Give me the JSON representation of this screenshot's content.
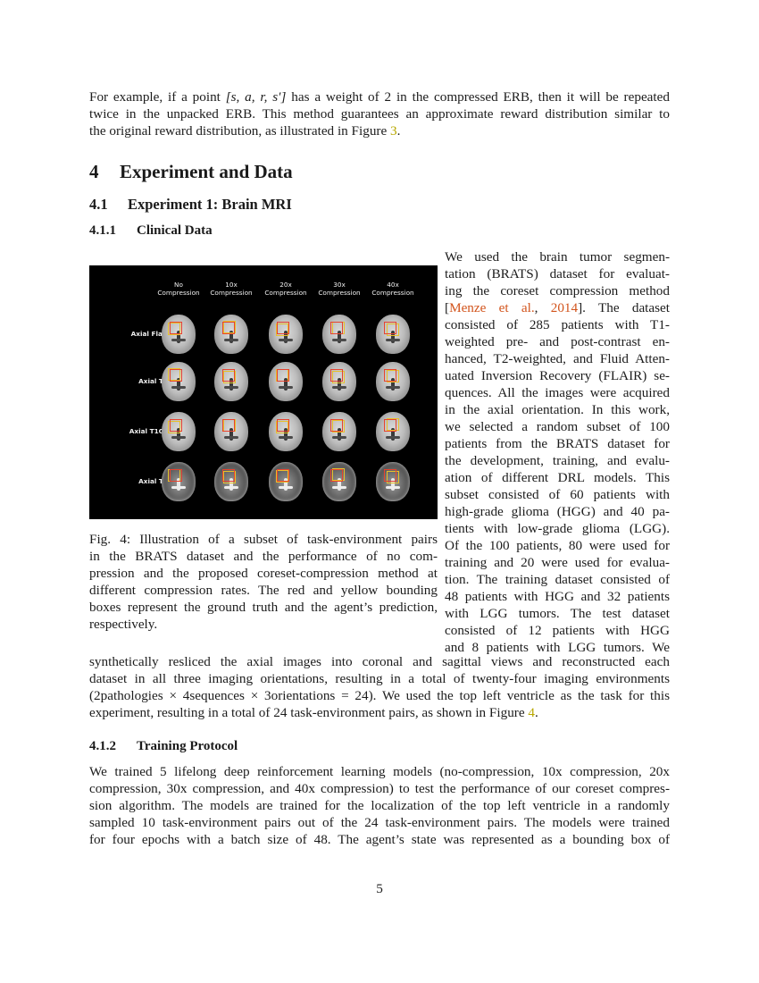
{
  "intro_paragraph": {
    "lines": [
      [
        "For example, if a point ",
        "[s, a, r, s′]",
        " has a weight of 2 in the compressed ERB, then it will be repeated"
      ],
      [
        "twice in the unpacked ERB. This method guarantees an approximate reward distribution similar to"
      ],
      [
        "the original reward distribution, as illustrated in Figure ",
        "3",
        "."
      ]
    ]
  },
  "section": {
    "number": "4",
    "title": "Experiment and Data"
  },
  "subsection": {
    "number": "4.1",
    "title": "Experiment 1: Brain MRI"
  },
  "subsubsection_1": {
    "number": "4.1.1",
    "title": "Clinical Data"
  },
  "figure": {
    "columns": [
      {
        "line1": "No",
        "line2": "Compression"
      },
      {
        "line1": "10x",
        "line2": "Compression"
      },
      {
        "line1": "20x",
        "line2": "Compression"
      },
      {
        "line1": "30x",
        "line2": "Compression"
      },
      {
        "line1": "40x",
        "line2": "Compression"
      }
    ],
    "rows": [
      "Axial Flair",
      "Axial T1",
      "Axial T1CE",
      "Axial T2"
    ],
    "ground_truth_color": "#e8432e",
    "prediction_color": "#e8c02a",
    "background_color": "#000000"
  },
  "caption": {
    "lines": [
      "Fig. 4: Illustration of a subset of task-environment pairs",
      "in the BRATS dataset and the performance of no com-",
      "pression and the proposed coreset-compression method at",
      "different compression rates. The red and yellow bounding",
      "boxes represent the ground truth and the agent’s prediction,",
      "respectively."
    ]
  },
  "right_column": {
    "lines": [
      "We used the brain tumor segmen-",
      "tation (BRATS) dataset for evaluat-",
      "ing the coreset compression method",
      [
        "[",
        "Menze et al.",
        ", ",
        "2014",
        "].  The dataset"
      ],
      "consisted of 285 patients with T1-",
      "weighted pre- and post-contrast en-",
      "hanced, T2-weighted, and Fluid Atten-",
      "uated Inversion Recovery (FLAIR) se-",
      "quences. All the images were acquired",
      "in the axial orientation. In this work,",
      "we selected a random subset of 100",
      "patients from the BRATS dataset for",
      "the development, training, and evalu-",
      "ation of different DRL models. This",
      "subset consisted of 60 patients with",
      "high-grade glioma (HGG) and 40 pa-",
      "tients with low-grade glioma (LGG).",
      "Of the 100 patients, 80 were used for",
      "training and 20 were used for evalua-",
      "tion. The training dataset consisted of",
      "48 patients with HGG and 32 patients",
      "with LGG tumors. The test dataset",
      "consisted of 12 patients with HGG",
      "and 8 patients with LGG tumors. We"
    ]
  },
  "full_paragraph": {
    "lines": [
      "synthetically resliced the axial images into coronal and sagittal views and reconstructed each",
      "dataset in all three imaging orientations, resulting in a total of twenty-four imaging environments",
      "(2pathologies × 4sequences × 3orientations = 24). We used the top left ventricle as the task for this",
      [
        "experiment, resulting in a total of 24 task-environment pairs, as shown in Figure ",
        "4",
        "."
      ]
    ]
  },
  "subsubsection_2": {
    "number": "4.1.2",
    "title": "Training Protocol"
  },
  "training_paragraph": {
    "lines": [
      "We trained 5 lifelong deep reinforcement learning models (no-compression, 10x compression, 20x",
      "compression, 30x compression, and 40x compression) to test the performance of our coreset compres-",
      "sion algorithm. The models are trained for the localization of the top left ventricle in a randomly",
      "sampled 10 task-environment pairs out of the 24 task-environment pairs. The models were trained",
      "for four epochs with a batch size of 48. The agent’s state was represented as a bounding box of"
    ]
  },
  "page_number": "5"
}
